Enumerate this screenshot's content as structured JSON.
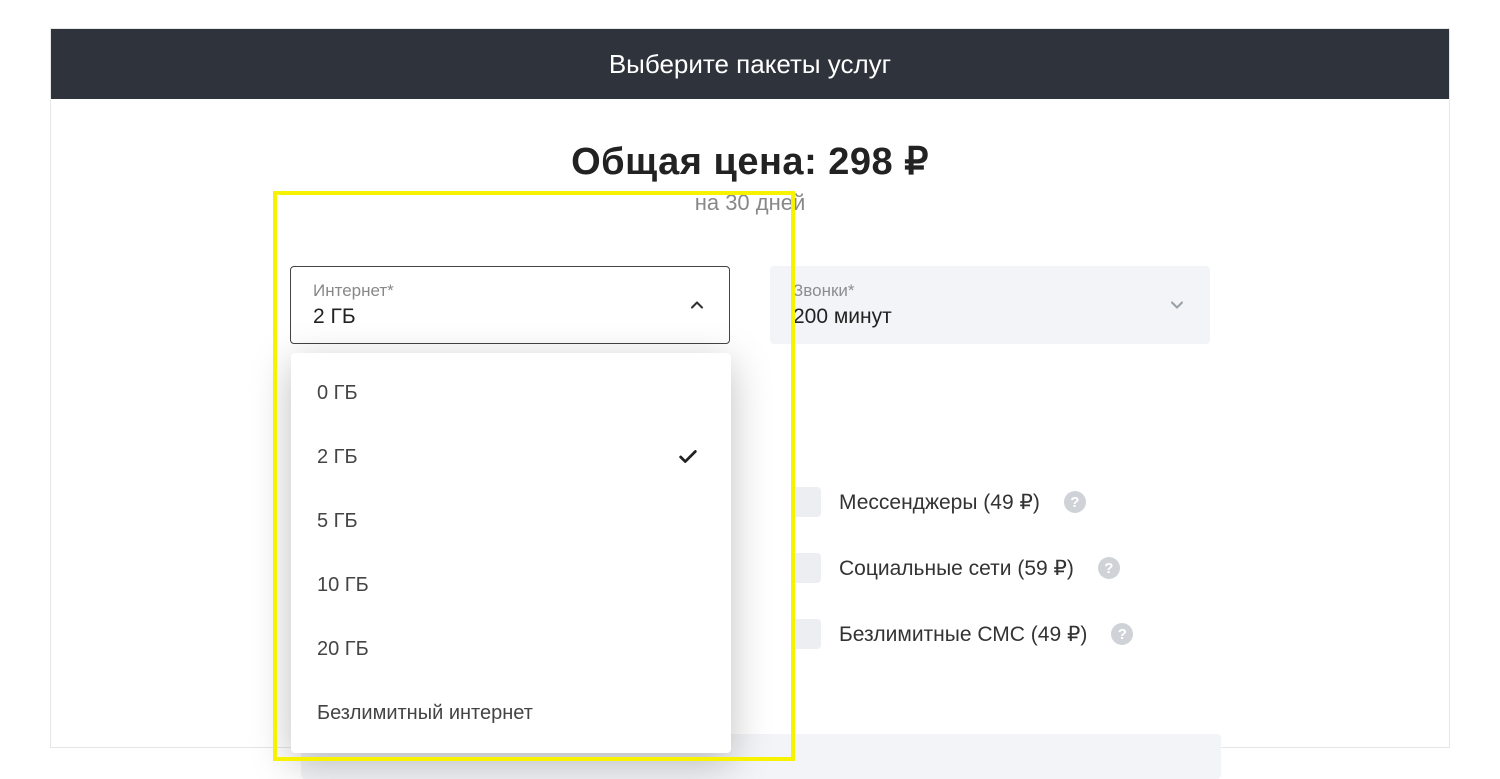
{
  "header": {
    "title": "Выберите пакеты услуг"
  },
  "price": {
    "label": "Общая цена:",
    "amount": "298",
    "currency": "₽",
    "period": "на 30 дней"
  },
  "internet": {
    "label": "Интернет*",
    "value": "2 ГБ",
    "options": [
      {
        "label": "0 ГБ",
        "selected": false
      },
      {
        "label": "2 ГБ",
        "selected": true
      },
      {
        "label": "5 ГБ",
        "selected": false
      },
      {
        "label": "10 ГБ",
        "selected": false
      },
      {
        "label": "20 ГБ",
        "selected": false
      },
      {
        "label": "Безлимитный интернет",
        "selected": false
      }
    ]
  },
  "calls": {
    "label": "Звонки*",
    "value": "200 минут"
  },
  "addons": [
    {
      "label": "Мессенджеры (49 ₽)"
    },
    {
      "label": "Социальные сети (59 ₽)"
    },
    {
      "label": "Безлимитные СМС (49 ₽)"
    }
  ],
  "colors": {
    "banner": "#2e333c",
    "highlight": "#f6f200",
    "muted_bg": "#f2f4f7"
  }
}
